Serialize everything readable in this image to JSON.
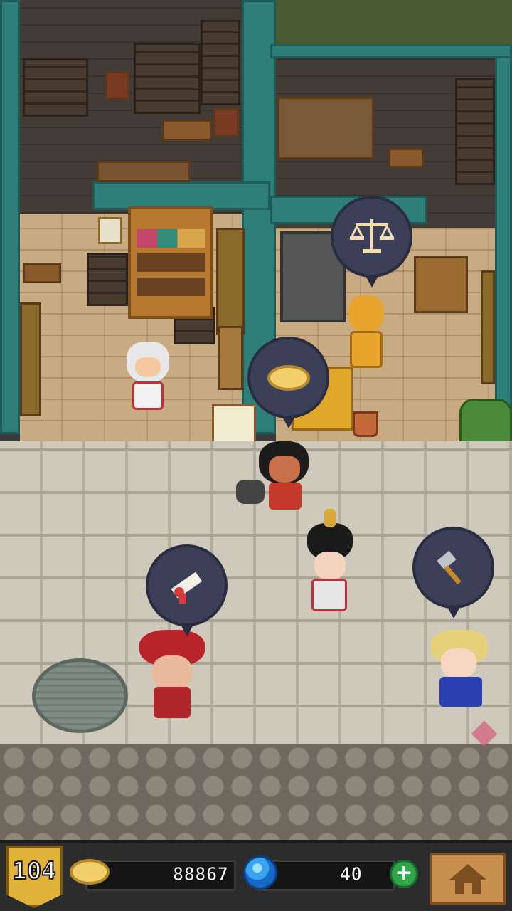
{
  "hud": {
    "level": "104",
    "coins": "88867",
    "gems": "40",
    "add_gems_label": "+",
    "icons": {
      "coin": "coin-icon",
      "gem": "gem-icon",
      "home": "home-icon"
    }
  },
  "bubbles": [
    {
      "name": "scales-bubble",
      "icon": "scales-icon"
    },
    {
      "name": "coin-bubble",
      "icon": "coin-icon"
    },
    {
      "name": "scroll-bubble",
      "icon": "scroll-icon"
    },
    {
      "name": "hammer-bubble",
      "icon": "hammer-icon"
    }
  ],
  "colors": {
    "badge": "#e2b33a",
    "gem": "#3aa3f0",
    "plus": "#2fa64a",
    "home": "#c98f4e"
  }
}
